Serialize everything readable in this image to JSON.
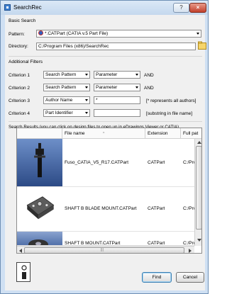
{
  "window": {
    "title": "SearchRec",
    "help_label": "?",
    "close_label": "×"
  },
  "basic_search": {
    "heading": "Basic Search",
    "pattern_label": "Pattern:",
    "pattern_value": "*.CATPart      (CATIA v.5 Part File)",
    "directory_label": "Directory:",
    "directory_value": "C:/Program Files (x86)/SearchRec"
  },
  "filters": {
    "heading": "Additional Filters",
    "criteria": [
      {
        "label": "Criterion 1",
        "field": "Search Pattern",
        "operator": "Parameter",
        "conj": "AND",
        "value": "",
        "hint": ""
      },
      {
        "label": "Criterion 2",
        "field": "Search Pattern",
        "operator": "Parameter",
        "conj": "AND",
        "value": "",
        "hint": ""
      },
      {
        "label": "Criterion 3",
        "field": "Author Name",
        "operator": "",
        "conj": "",
        "value": "*",
        "hint": "[* represents all authors]"
      },
      {
        "label": "Criterion 4",
        "field": "Part Identifier",
        "operator": "",
        "conj": "",
        "value": "",
        "hint": "[substring in file name]"
      }
    ]
  },
  "results": {
    "heading": "Search Results (you can click on design files to open up in eDrawings Viewer or CATIA)",
    "columns": [
      "File name",
      "Extension",
      "Full pat"
    ],
    "rows": [
      {
        "file": "Fuso_CATIA_V5_R17.CATPart",
        "ext": "CATPart",
        "path": "C:/Proc"
      },
      {
        "file": "SHAFT B BLADE MOUNT.CATPart",
        "ext": "CATPart",
        "path": "C:/Proc"
      },
      {
        "file": "SHAFT B MOUNT.CATPart",
        "ext": "CATPart",
        "path": "C:/Proc"
      }
    ],
    "scroll_grip": "|||"
  },
  "buttons": {
    "find": "Find",
    "cancel": "Cancel"
  },
  "colors": {
    "accent": "#3c7fb1",
    "thumb_blue": "#3a5f9e",
    "title_bg": "#cfe0f3"
  }
}
